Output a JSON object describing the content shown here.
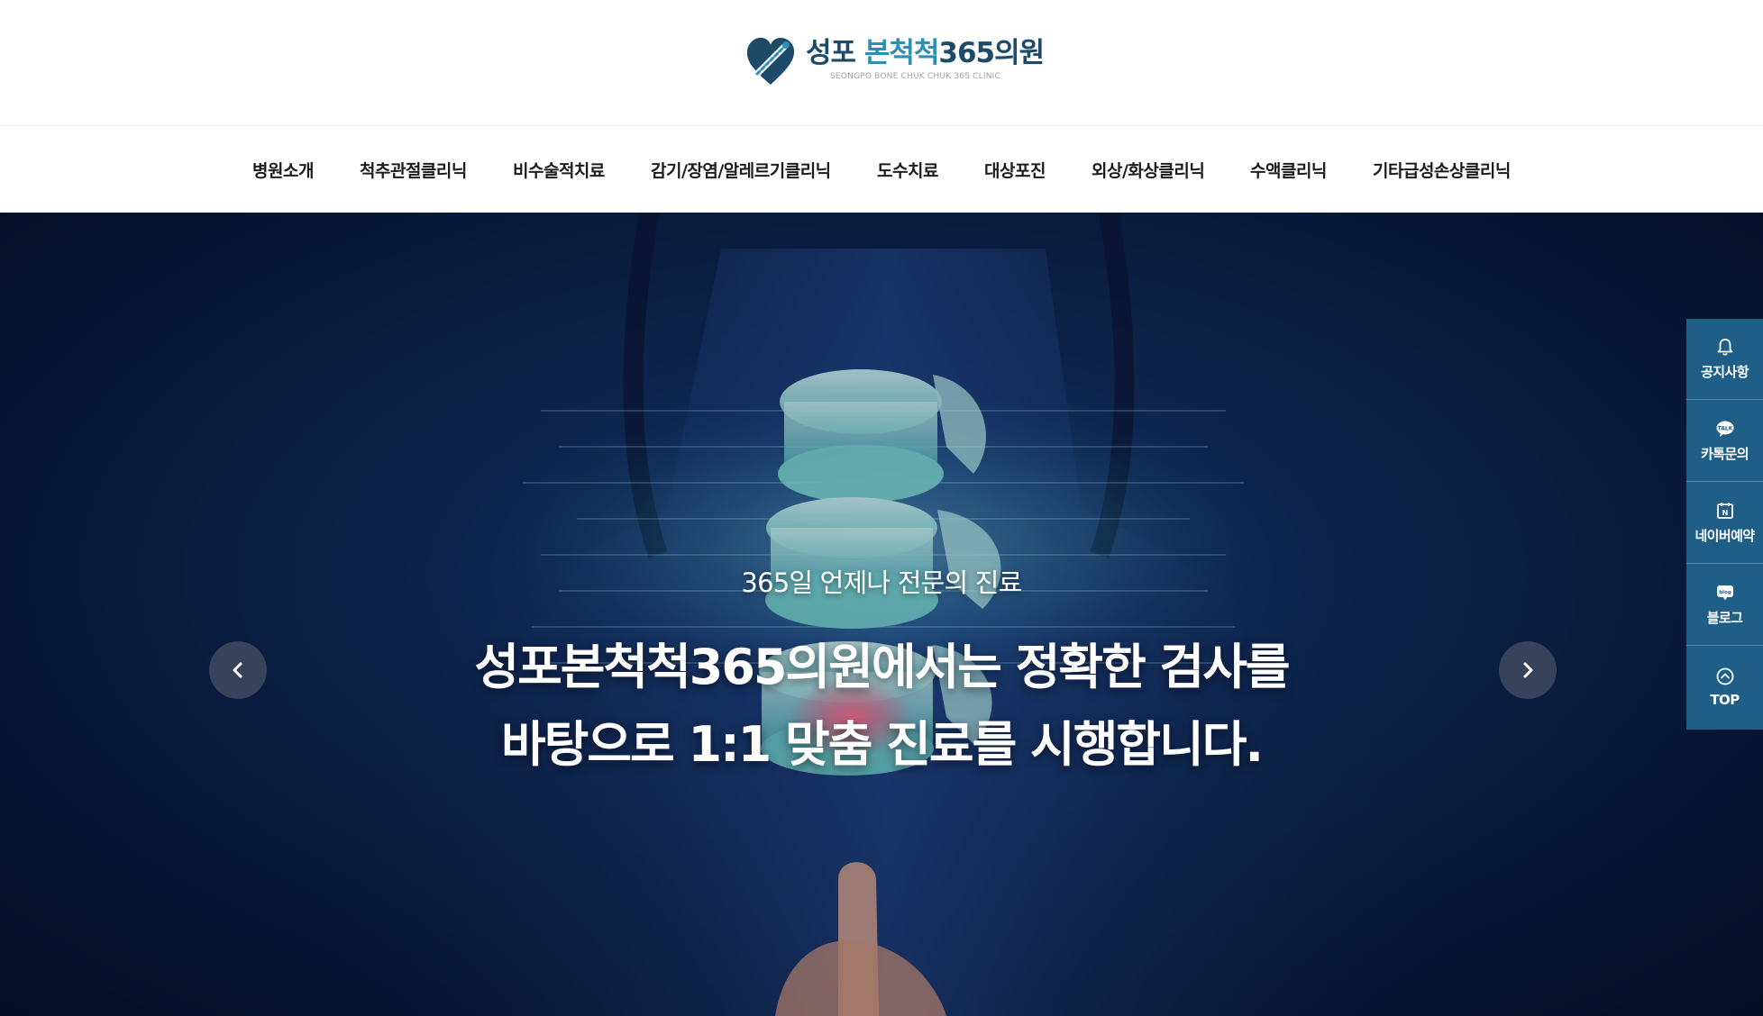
{
  "header": {
    "logo": {
      "title_main": "성포 ",
      "title_accent": "본척척",
      "title_tail": "365의원",
      "subtitle": "SEONGPO BONE CHUK CHUK 365 CLINIC",
      "brand_color": "#1e4a6a",
      "accent_color": "#2d8fb3"
    }
  },
  "nav": {
    "items": [
      {
        "label": "병원소개"
      },
      {
        "label": "척추관절클리닉"
      },
      {
        "label": "비수술적치료"
      },
      {
        "label": "감기/장염/알레르기클리닉"
      },
      {
        "label": "도수치료"
      },
      {
        "label": "대상포진"
      },
      {
        "label": "외상/화상클리닉"
      },
      {
        "label": "수액클리닉"
      },
      {
        "label": "기타급성손상클리닉"
      }
    ]
  },
  "hero": {
    "subtitle": "365일 언제나 전문의 진료",
    "title_line1": "성포본척척365의원에서는 정확한 검사를",
    "title_line2": "바탕으로 1:1 맞춤 진료를 시행합니다.",
    "prev_icon": "chevron-left-icon",
    "next_icon": "chevron-right-icon",
    "background_color": "#0d2550"
  },
  "quick_menu": {
    "background_color": "#1f5f87",
    "items": [
      {
        "label": "공지사항",
        "icon": "bell-icon"
      },
      {
        "label": "카톡문의",
        "icon": "kakao-talk-icon"
      },
      {
        "label": "네이버예약",
        "icon": "naver-calendar-icon"
      },
      {
        "label": "블로그",
        "icon": "blog-icon"
      },
      {
        "label": "TOP",
        "icon": "chevron-up-circle-icon"
      }
    ]
  }
}
